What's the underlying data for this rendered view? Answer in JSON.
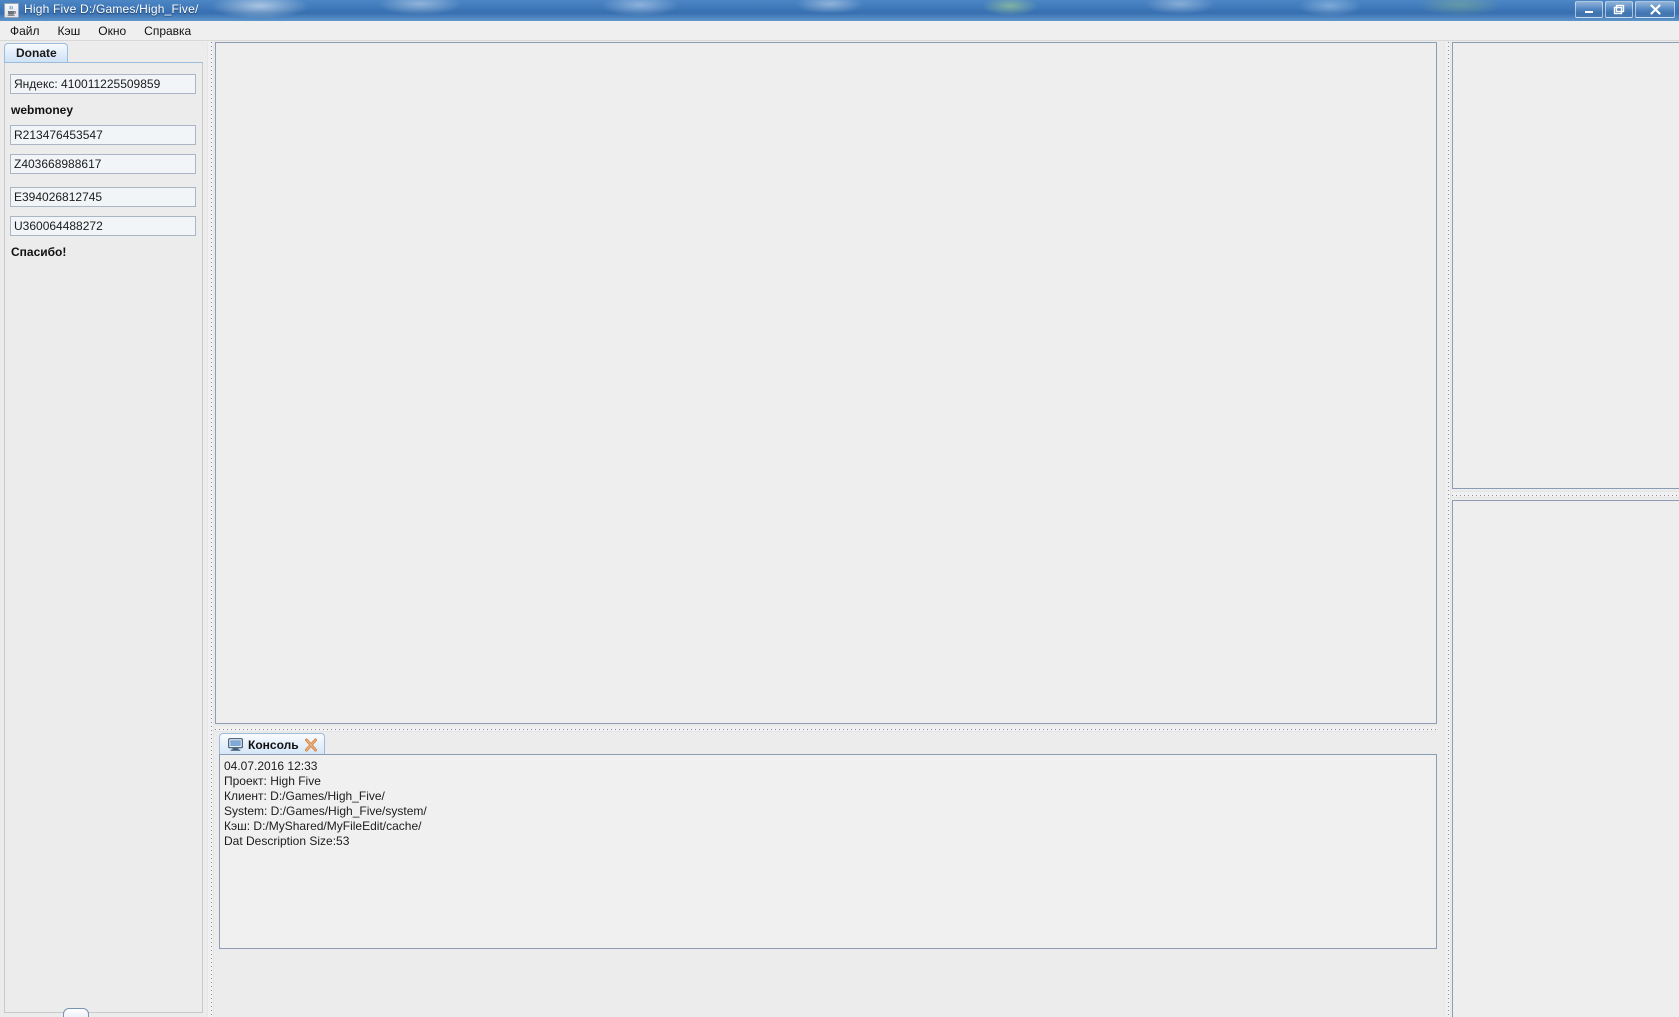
{
  "window": {
    "title": "High Five D:/Games/High_Five/",
    "icon": "java-cup-icon",
    "controls": {
      "minimize": "–",
      "maximize": "❐",
      "close": "✕"
    }
  },
  "menubar": {
    "items": [
      {
        "label": "Файл",
        "name": "menu-file"
      },
      {
        "label": "Кэш",
        "name": "menu-cache"
      },
      {
        "label": "Окно",
        "name": "menu-window"
      },
      {
        "label": "Справка",
        "name": "menu-help"
      }
    ]
  },
  "sidebar": {
    "tab_label": "Donate",
    "yandex_field": "Яндекс: 410011225509859",
    "webmoney_label": "webmoney",
    "wm_r": "R213476453547",
    "wm_z": "Z403668988617",
    "wm_e": "E394026812745",
    "wm_u": "U360064488272",
    "thanks_label": "Спасибо!"
  },
  "console": {
    "tab_label": "Консоль",
    "tab_icon": "monitor-icon",
    "close_icon": "close-x-icon",
    "log_lines": [
      "04.07.2016 12:33",
      "Проект: High Five",
      "Клиент: D:/Games/High_Five/",
      "System: D:/Games/High_Five/system/",
      "Кэш: D:/MyShared/MyFileEdit/cache/",
      "Dat Description Size:53"
    ]
  },
  "colors": {
    "titlebar_blue": "#3f79ba",
    "panel_gray": "#eeeeee",
    "tab_blue": "#cfe2f6",
    "border_blue": "#8c9cb4",
    "close_orange": "#d98a47"
  }
}
